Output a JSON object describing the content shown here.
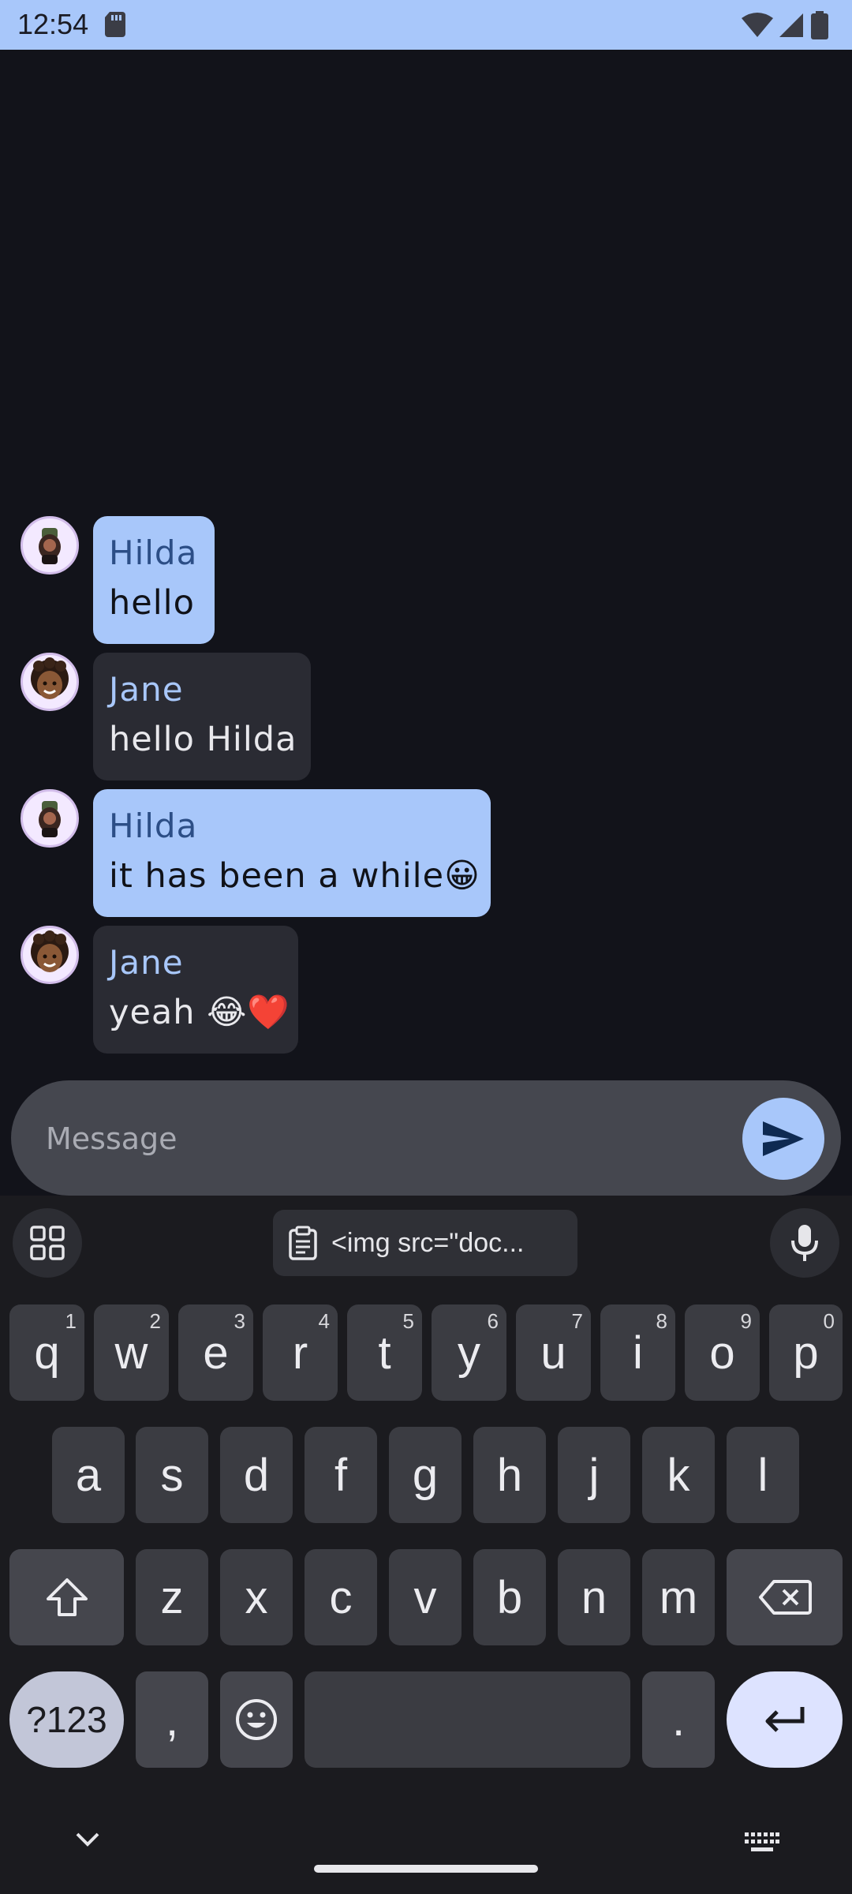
{
  "status_bar": {
    "time": "12:54",
    "icons": [
      "sd-card-icon",
      "wifi-icon",
      "cellular-signal-icon",
      "battery-icon"
    ]
  },
  "conversation": {
    "messages": [
      {
        "sender": "Hilda",
        "text": "hello",
        "mine": true,
        "avatar": "memoji-hilda"
      },
      {
        "sender": "Jane",
        "text": "hello Hilda",
        "mine": false,
        "avatar": "memoji-jane"
      },
      {
        "sender": "Hilda",
        "text": "it has been a while😀",
        "mine": true,
        "avatar": "memoji-hilda"
      },
      {
        "sender": "Jane",
        "text": "yeah 😂❤️",
        "mine": false,
        "avatar": "memoji-jane"
      }
    ]
  },
  "composer": {
    "placeholder": "Message",
    "value": ""
  },
  "keyboard": {
    "clipboard_chip": "<img src=\"doc...",
    "row1": [
      {
        "key": "q",
        "hint": "1"
      },
      {
        "key": "w",
        "hint": "2"
      },
      {
        "key": "e",
        "hint": "3"
      },
      {
        "key": "r",
        "hint": "4"
      },
      {
        "key": "t",
        "hint": "5"
      },
      {
        "key": "y",
        "hint": "6"
      },
      {
        "key": "u",
        "hint": "7"
      },
      {
        "key": "i",
        "hint": "8"
      },
      {
        "key": "o",
        "hint": "9"
      },
      {
        "key": "p",
        "hint": "0"
      }
    ],
    "row2": [
      "a",
      "s",
      "d",
      "f",
      "g",
      "h",
      "j",
      "k",
      "l"
    ],
    "row3": [
      "z",
      "x",
      "c",
      "v",
      "b",
      "n",
      "m"
    ],
    "symbols_label": "?123",
    "comma": ",",
    "period": "."
  },
  "colors": {
    "status_bar": "#a8c7fa",
    "background": "#12131a",
    "my_bubble": "#a8c7fa",
    "their_bubble": "#2a2b33",
    "composer": "#45474f",
    "send_button": "#a8c7fa"
  }
}
